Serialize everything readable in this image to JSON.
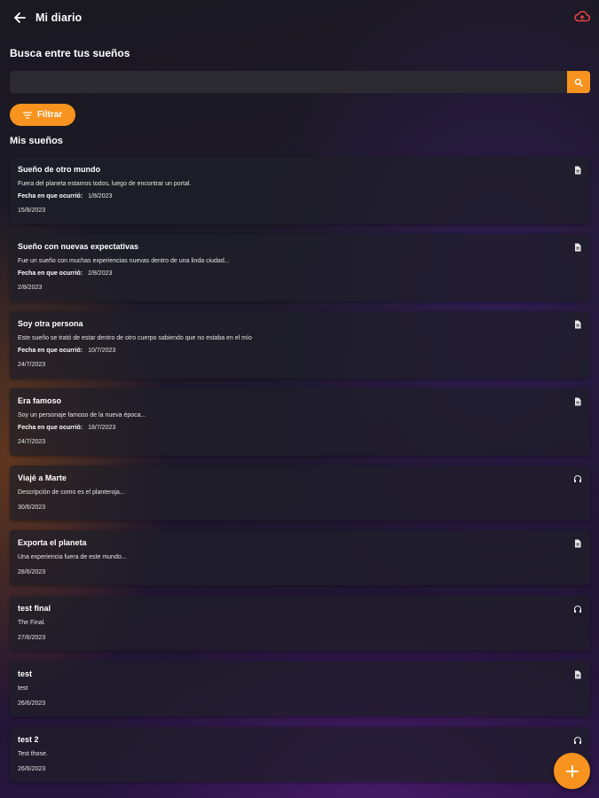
{
  "header": {
    "title": "Mi diario",
    "back_icon": "arrow-left-icon",
    "cloud_icon": "cloud-upload-icon"
  },
  "search": {
    "title": "Busca entre tus sueños",
    "value": "",
    "placeholder": "",
    "button_icon": "search-icon"
  },
  "filter": {
    "label": "Filtrar",
    "icon": "filter-icon"
  },
  "section": {
    "title": "Mis sueños"
  },
  "dreams": [
    {
      "title": "Sueño de otro mundo",
      "description": "Fuera del planeta estamos todos, luego de encontrar un portal.",
      "occurred_label": "Fecha en que ocurrió:",
      "occurred_date": "1/8/2023",
      "date": "15/8/2023",
      "type_icon": "document-icon"
    },
    {
      "title": "Sueño con nuevas expectativas",
      "description": "Fue un sueño con muchas experiencias nuevas dentro de una linda ciudad...",
      "occurred_label": "Fecha en que ocurrió:",
      "occurred_date": "2/8/2023",
      "date": "2/8/2023",
      "type_icon": "document-icon"
    },
    {
      "title": "Soy otra persona",
      "description": "Este sueño se trató de estar dentro de otro cuerpo sabiendo que no estaba en el mío",
      "occurred_label": "Fecha en que ocurrió:",
      "occurred_date": "10/7/2023",
      "date": "24/7/2023",
      "type_icon": "document-icon"
    },
    {
      "title": "Era famoso",
      "description": "Soy un personaje famoso de la nueva época...",
      "occurred_label": "Fecha en que ocurrió:",
      "occurred_date": "18/7/2023",
      "date": "24/7/2023",
      "type_icon": "document-icon"
    },
    {
      "title": "Viajé a Marte",
      "description": "Descripción de como es el planteroja...",
      "date": "30/6/2023",
      "type_icon": "headphones-icon"
    },
    {
      "title": "Exporta el planeta",
      "description": "Una experiencia fuera de este mundo...",
      "date": "28/6/2023",
      "type_icon": "document-icon"
    },
    {
      "title": "test final",
      "description": "The Final.",
      "date": "27/6/2023",
      "type_icon": "headphones-icon"
    },
    {
      "title": "test",
      "description": "test",
      "date": "26/6/2023",
      "type_icon": "document-icon"
    },
    {
      "title": "test 2",
      "description": "Test those.",
      "date": "26/6/2023",
      "type_icon": "headphones-icon"
    }
  ],
  "fab": {
    "icon": "plus-icon"
  },
  "colors": {
    "accent": "#f7931e",
    "cloud": "#e0433a",
    "card": "#1e1e28",
    "search_field": "#2a2a30"
  }
}
